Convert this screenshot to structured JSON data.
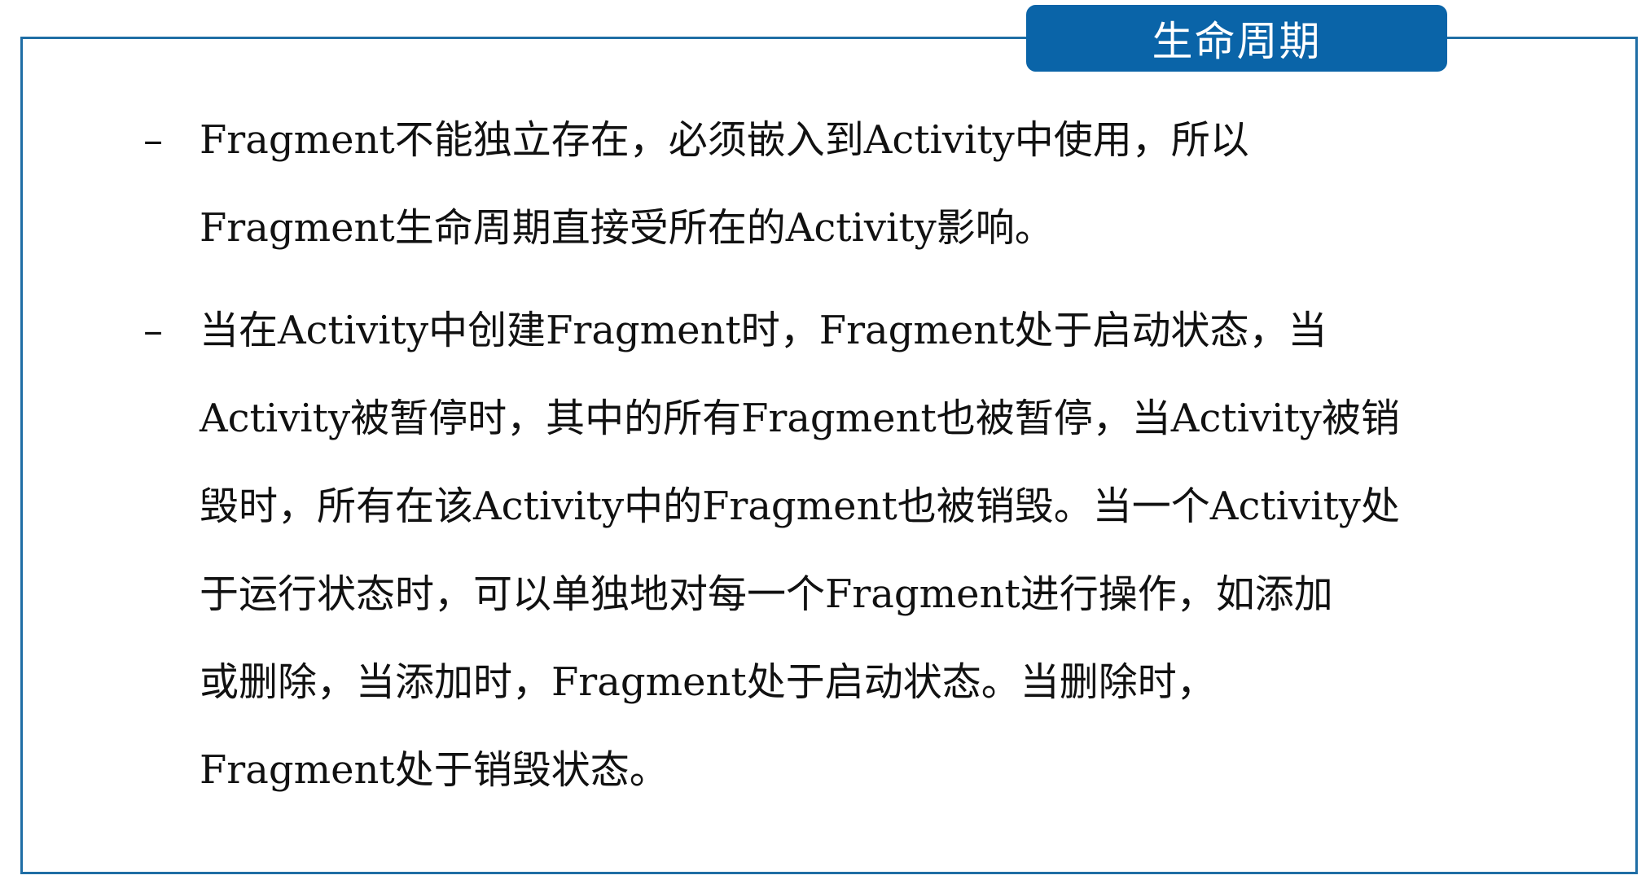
{
  "title": "生命周期",
  "bullet_marker": "–",
  "bullets": [
    {
      "lines": [
        "Fragment不能独立存在，必须嵌入到Activity中使用，所以",
        "Fragment生命周期直接受所在的Activity影响。"
      ]
    },
    {
      "lines": [
        "当在Activity中创建Fragment时，Fragment处于启动状态，当",
        "Activity被暂停时，其中的所有Fragment也被暂停，当Activity被销",
        "毁时，所有在该Activity中的Fragment也被销毁。当一个Activity处",
        "于运行状态时，可以单独地对每一个Fragment进行操作，如添加",
        "或删除，当添加时，Fragment处于启动状态。当删除时，",
        "Fragment处于销毁状态。"
      ]
    }
  ],
  "colors": {
    "accent": "#0a64a8",
    "border": "#1f6ea5",
    "text": "#111111"
  }
}
